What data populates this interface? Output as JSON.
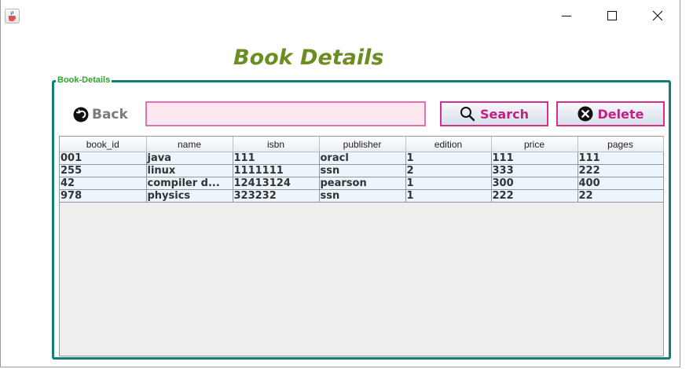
{
  "window": {
    "icons": {
      "app": "java-cup-icon",
      "minimize": "minimize-icon",
      "maximize": "maximize-icon",
      "close": "close-icon"
    }
  },
  "page": {
    "title": "Book Details",
    "panel_label": "Book-Details"
  },
  "toolbar": {
    "back_label": "Back",
    "back_icon": "back-arrow-icon",
    "search_value": "",
    "search_label": "Search",
    "search_icon": "magnifier-icon",
    "delete_label": "Delete",
    "delete_icon": "x-circle-icon"
  },
  "colors": {
    "title": "#6b8e23",
    "panel_border": "#0f7f7a",
    "panel_label": "#2ea12e",
    "button_text": "#c41f86",
    "button_border": "#d6308f",
    "input_bg": "#fde8f0"
  },
  "table": {
    "columns": [
      "book_id",
      "name",
      "isbn",
      "publisher",
      "edition",
      "price",
      "pages"
    ],
    "rows": [
      [
        "001",
        "java",
        "111",
        "oracl",
        "1",
        "111",
        "111"
      ],
      [
        "255",
        "linux",
        "1111111",
        "ssn",
        "2",
        "333",
        "222"
      ],
      [
        "42",
        "compiler d...",
        "12413124",
        "pearson",
        "1",
        "300",
        "400"
      ],
      [
        "978",
        "physics",
        "323232",
        "ssn",
        "1",
        "222",
        "22"
      ]
    ]
  }
}
